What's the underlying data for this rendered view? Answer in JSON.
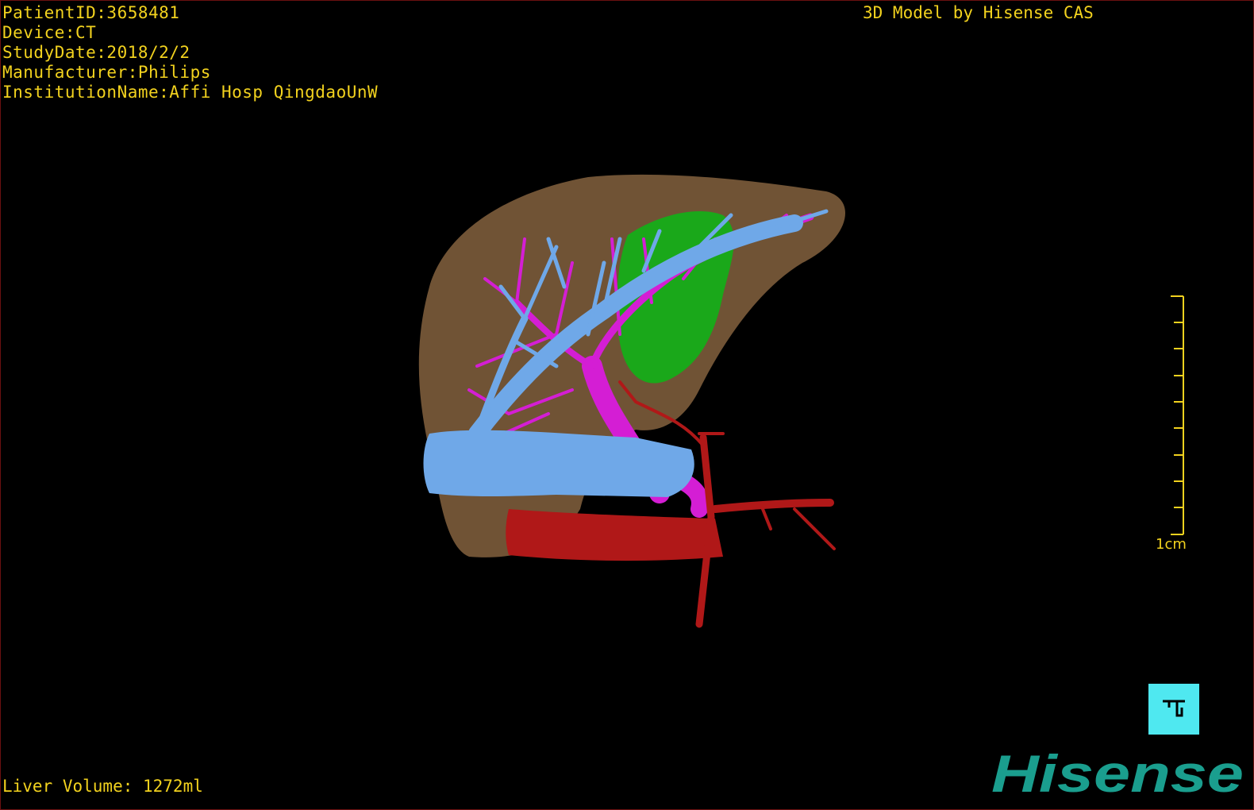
{
  "info": {
    "patient_id": "PatientID:3658481",
    "device": "Device:CT",
    "study_date": "StudyDate:2018/2/2",
    "manufacturer": "Manufacturer:Philips",
    "institution": "InstitutionName:Affi Hosp QingdaoUnW"
  },
  "credit": "3D Model by Hisense CAS",
  "liver_volume": "Liver Volume: 1272ml",
  "scale": {
    "label": "1cm"
  },
  "brand": {
    "name": "Hisense",
    "color": "#1a9e8e"
  },
  "colors": {
    "background": "#000000",
    "overlay_text": "#f2d21e",
    "liver": "#7a5a3a",
    "gallbladder": "#1aa81a",
    "hepatic_vein": "#6fa8e8",
    "portal_vein": "#d41ed4",
    "artery": "#b01818",
    "view_button": "#4fe8f0"
  },
  "view_button": {
    "icon": "view-reset-icon"
  }
}
